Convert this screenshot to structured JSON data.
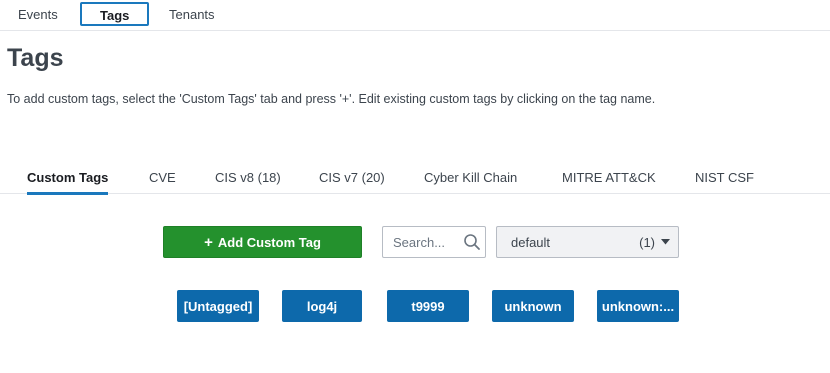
{
  "top_tabs": [
    "Events",
    "Tags",
    "Tenants"
  ],
  "page": {
    "title": "Tags",
    "description": "To add custom tags, select the 'Custom Tags' tab and press '+'.  Edit existing custom tags by clicking on the tag name."
  },
  "sub_tabs": [
    "Custom Tags",
    "CVE",
    "CIS v8 (18)",
    "CIS v7 (20)",
    "Cyber Kill Chain",
    "MITRE ATT&CK",
    "NIST CSF"
  ],
  "toolbar": {
    "add_label": "Add Custom Tag",
    "search_placeholder": "Search...",
    "select_value": "default",
    "select_count": "(1)"
  },
  "tags": [
    "[Untagged]",
    "log4j",
    "t9999",
    "unknown",
    "unknown:..."
  ],
  "colors": {
    "accent": "#1a78bd",
    "add_button": "#24912d",
    "tag_bg": "#0d69ab"
  }
}
